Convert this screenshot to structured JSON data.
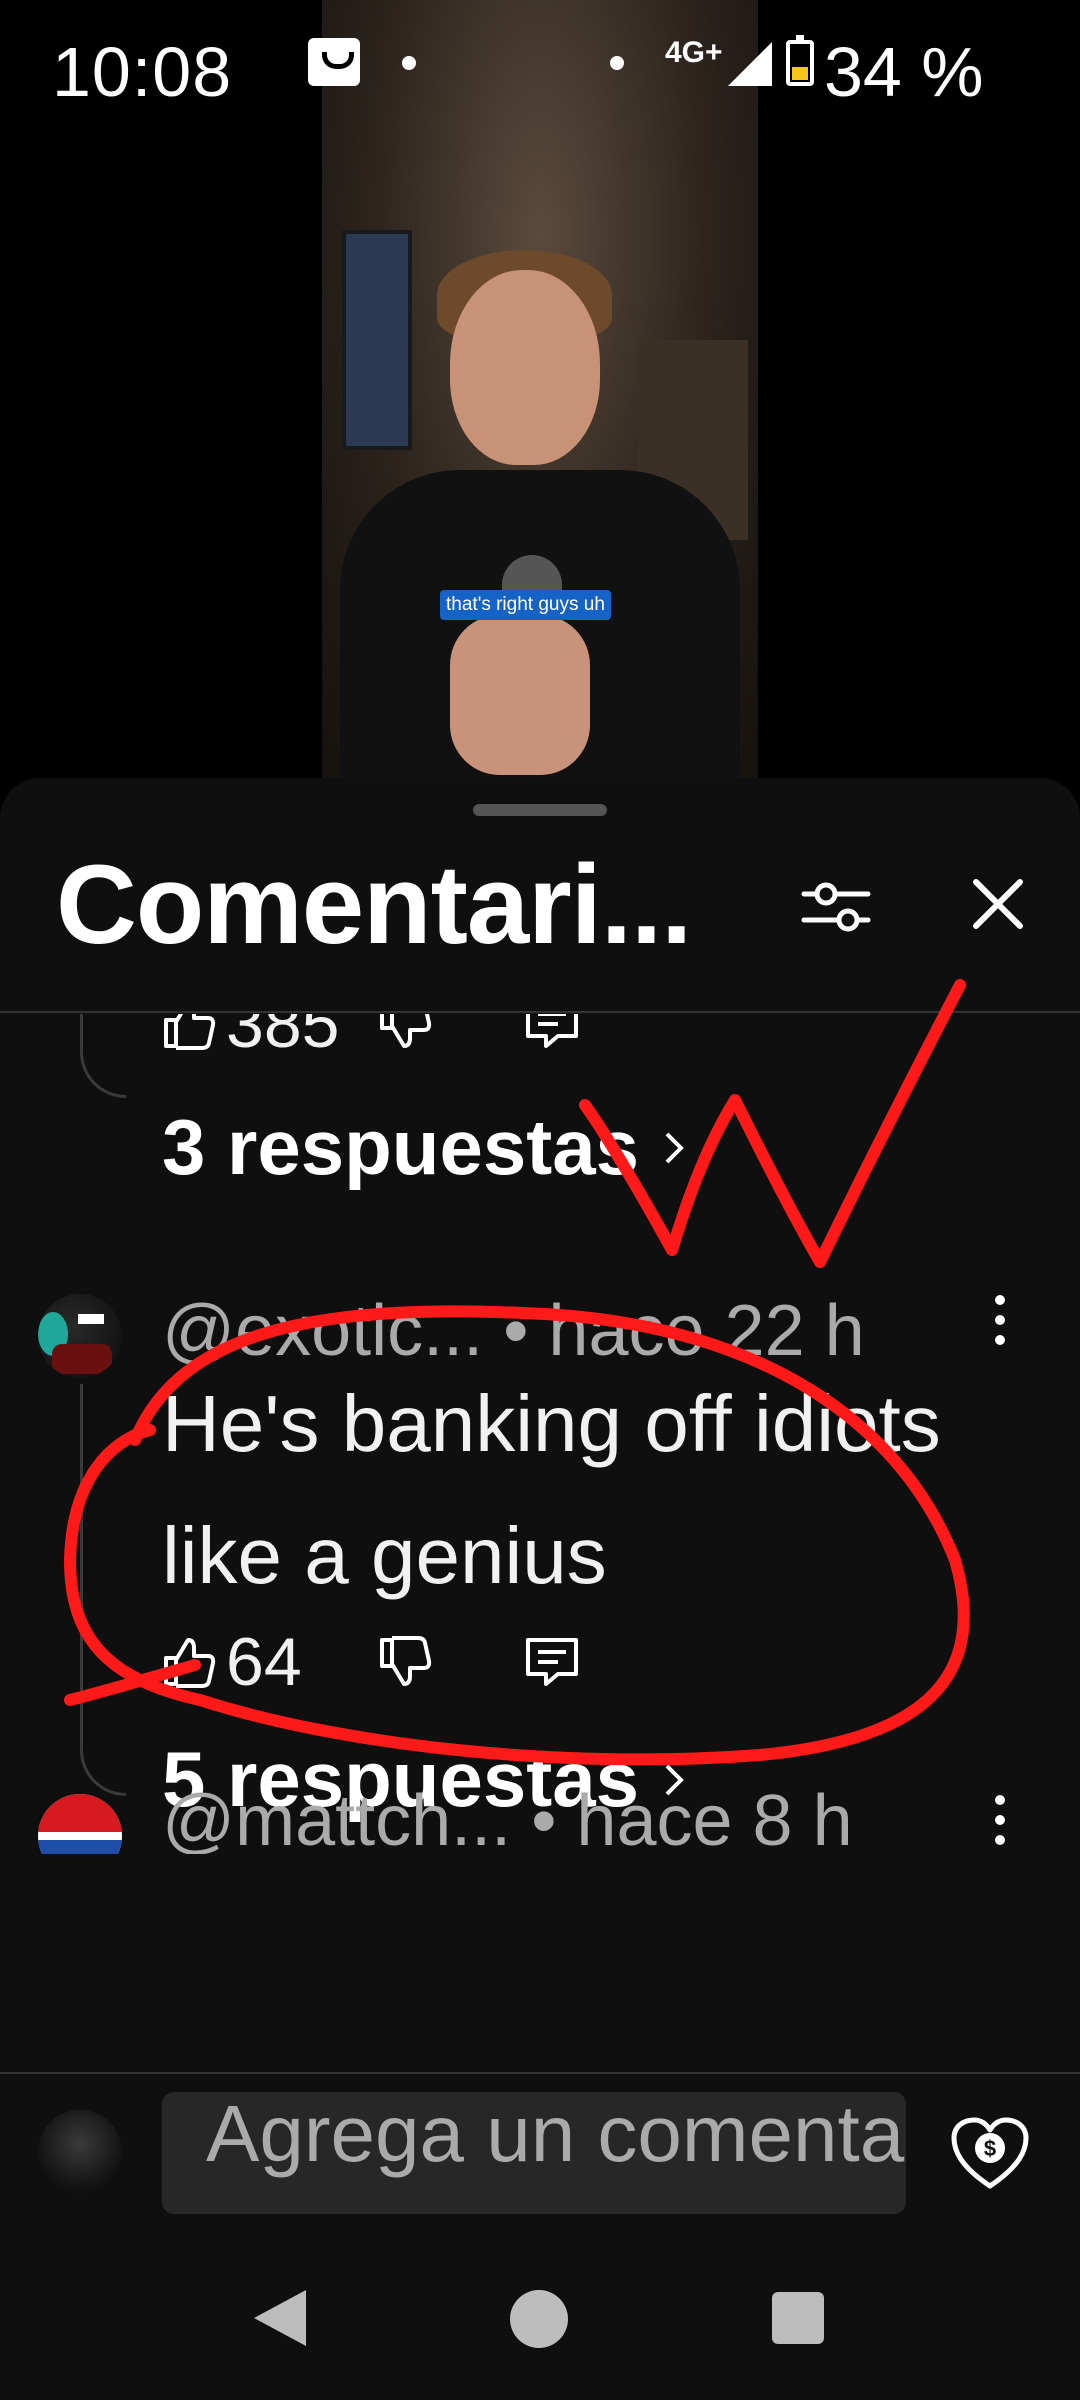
{
  "status_bar": {
    "time": "10:08",
    "network": "4G+",
    "battery_percent": "34 %",
    "battery_level": 0.34
  },
  "video": {
    "caption": "that's right guys uh"
  },
  "sheet": {
    "title": "Comentari...",
    "filter_icon": "sliders-icon",
    "close_icon": "close-icon"
  },
  "comments": [
    {
      "likes": "385",
      "replies_label": "3 respuestas"
    },
    {
      "author": "@exotic...",
      "time_ago": "• hace 22 h",
      "text": "He's banking off idiots like a genius",
      "likes": "64",
      "replies_label": "5 respuestas"
    },
    {
      "author": "@mattch...",
      "time_ago": "• hace 8 h"
    }
  ],
  "composer": {
    "placeholder": "Agrega un comentario...",
    "thanks_icon": "heart-dollar-icon"
  },
  "colors": {
    "sheet_bg": "#0f0f0f",
    "annotation_red": "#ff1a1a",
    "caption_bg": "#1663c7"
  }
}
